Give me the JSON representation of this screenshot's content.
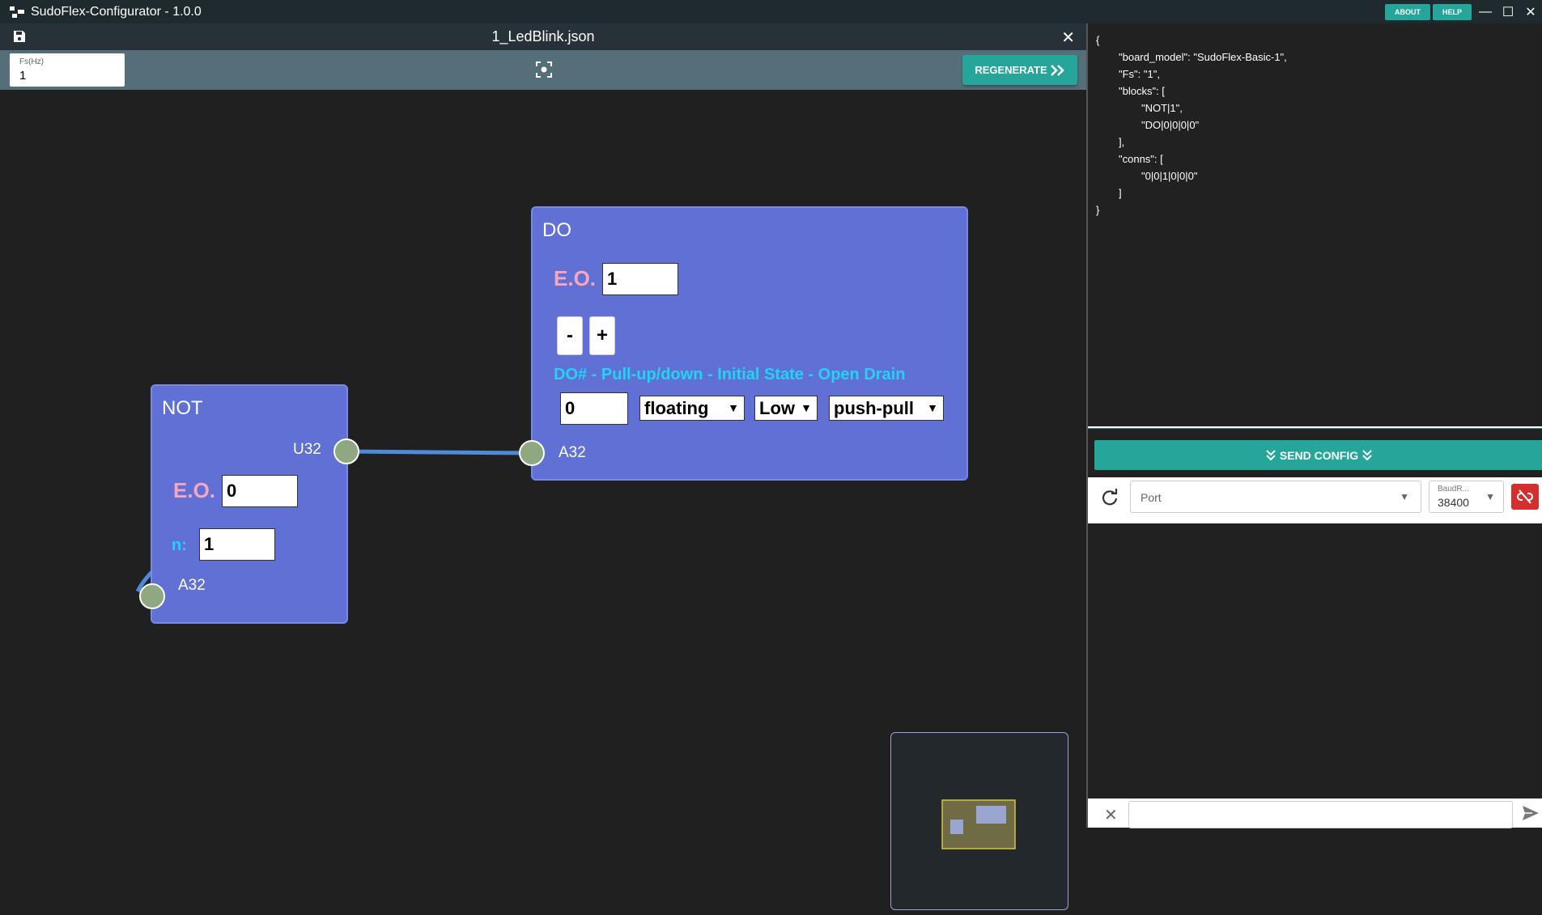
{
  "app": {
    "title": "SudoFlex-Configurator - 1.0.0",
    "about_label": "ABOUT",
    "help_label": "HELP"
  },
  "tab": {
    "file_name": "1_LedBlink.json"
  },
  "toolbar": {
    "fs_label": "Fs(Hz)",
    "fs_value": "1",
    "regenerate_label": "REGENERATE"
  },
  "blocks": {
    "not": {
      "name": "NOT",
      "eo_label": "E.O.",
      "eo_value": "0",
      "n_label": "n:",
      "n_value": "1",
      "out_port": "U32",
      "in_port": "A32"
    },
    "do": {
      "name": "DO",
      "eo_label": "E.O.",
      "eo_value": "1",
      "minus_label": "-",
      "plus_label": "+",
      "params_label": "DO# - Pull-up/down - Initial State - Open Drain",
      "do_num": "0",
      "pull": "floating",
      "initial_state": "Low",
      "drain": "push-pull",
      "in_port": "A32"
    }
  },
  "json_preview": {
    "l1": "{",
    "l2": "\"board_model\": \"SudoFlex-Basic-1\",",
    "l3": "\"Fs\": \"1\",",
    "l4": "\"blocks\": [",
    "l5": "\"NOT|1\",",
    "l6": "\"DO|0|0|0|0\"",
    "l7": "],",
    "l8": "\"conns\": [",
    "l9": "\"0|0|1|0|0|0\"",
    "l10": "]",
    "l11": "}"
  },
  "serial": {
    "send_config_label": "SEND CONFIG",
    "port_placeholder": "Port",
    "baud_label": "BaudR...",
    "baud_value": "38400"
  },
  "colors": {
    "accent": "#26a69a",
    "block": "#6070d4",
    "eo_label": "#f4a7c0",
    "cyan_label": "#22d3f2",
    "disconnect": "#d32f2f"
  }
}
